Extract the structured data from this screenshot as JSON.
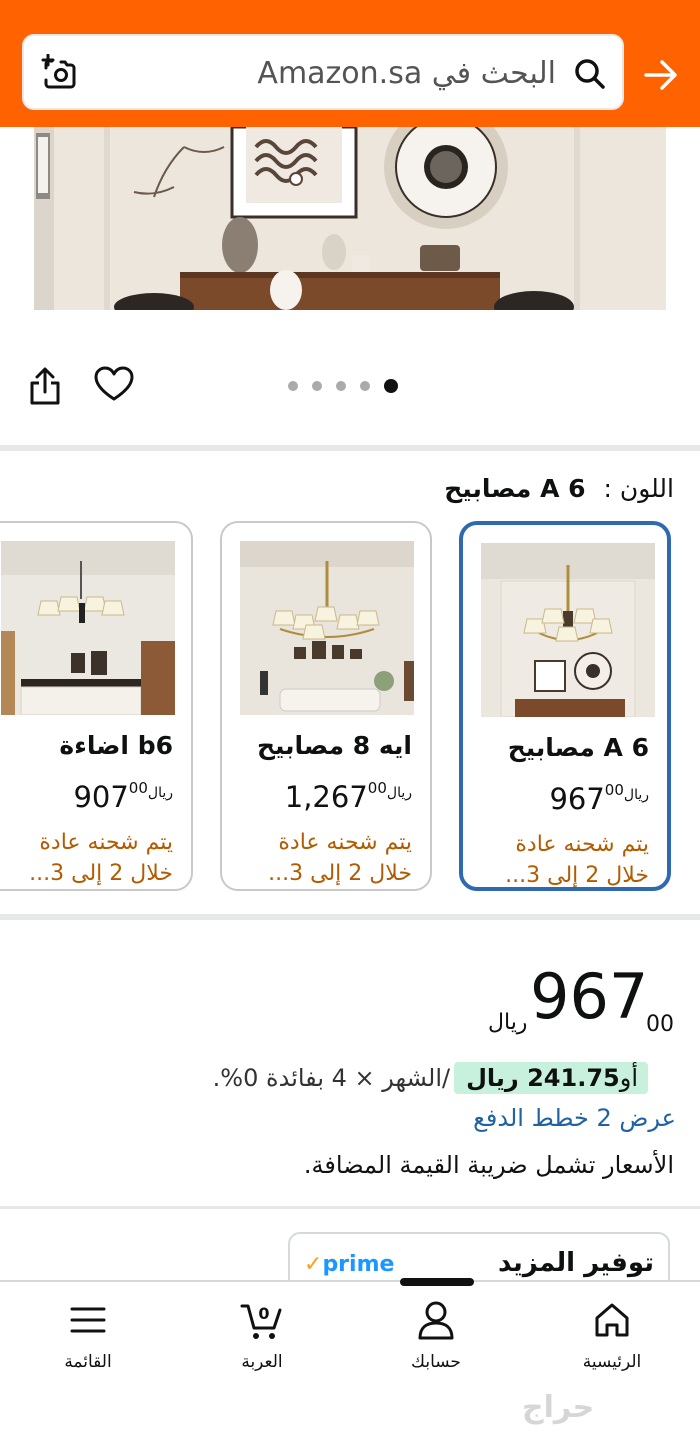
{
  "header": {
    "search_placeholder": "البحث في Amazon.sa",
    "colors": {
      "bar": "#ff6200"
    }
  },
  "gallery": {
    "image_count": 5,
    "active_index": 0
  },
  "variant": {
    "label": "اللون :",
    "selected_value": "6 A مصابيح"
  },
  "cards": [
    {
      "title": "6 A مصابيح",
      "price_whole": "967",
      "price_fraction": "00",
      "currency": "ريال",
      "shipping": "يتم شحنه عادة خلال 2 إلى 3...",
      "selected": true
    },
    {
      "title": "ايه 8 مصابيح",
      "price_whole": "1,267",
      "price_fraction": "00",
      "currency": "ريال",
      "shipping": "يتم شحنه عادة خلال 2 إلى 3...",
      "selected": false
    },
    {
      "title": "b6 اضاءة",
      "price_whole": "907",
      "price_fraction": "00",
      "currency": "ريال",
      "shipping": "يتم شحنه عادة خلال 2 إلى 3...",
      "selected": false
    }
  ],
  "price": {
    "whole": "967",
    "fraction": "00",
    "currency": "ريال",
    "installment_prefix": "أو",
    "installment_amount": "241.75 ريال",
    "installment_rest": "/الشهر × 4 بفائدة 0%.",
    "payment_plans_link": "عرض 2 خطط الدفع",
    "vat_note": "الأسعار تشمل ضريبة القيمة المضافة."
  },
  "prime_card": {
    "title": "توفير المزيد",
    "logo": "prime",
    "logo_check": "✓"
  },
  "bottom_nav": [
    {
      "label": "الرئيسية",
      "icon": "home-icon"
    },
    {
      "label": "حسابك",
      "icon": "account-icon"
    },
    {
      "label": "العربة",
      "icon": "cart-icon",
      "count": "0"
    },
    {
      "label": "القائمة",
      "icon": "menu-icon"
    }
  ],
  "watermark": "حراج"
}
